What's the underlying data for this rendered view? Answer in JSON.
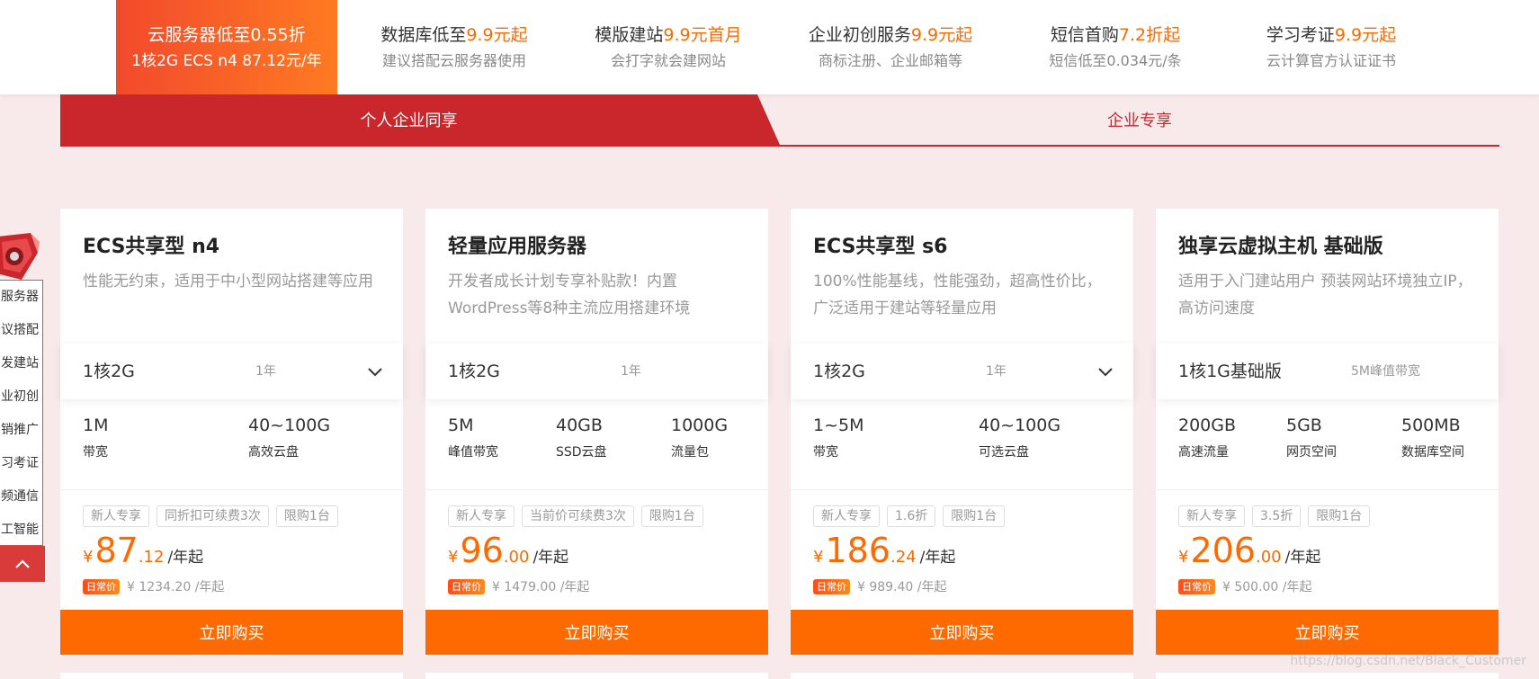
{
  "topnav": {
    "items": [
      {
        "title": "云服务器低至0.55折",
        "title_pre": "云服务器低至",
        "title_hl": "0.55折",
        "sub": "1核2G ECS n4 87.12元/年",
        "active": true
      },
      {
        "title_pre": "数据库低至",
        "title_hl": "9.9元起",
        "sub": "建议搭配云服务器使用"
      },
      {
        "title_pre": "模版建站",
        "title_hl": "9.9元首月",
        "sub": "会打字就会建网站"
      },
      {
        "title_pre": "企业初创服务",
        "title_hl": "9.9元起",
        "sub": "商标注册、企业邮箱等"
      },
      {
        "title_pre": "短信首购",
        "title_hl": "7.2折起",
        "sub": "短信低至0.034元/条"
      },
      {
        "title_pre": "学习考证",
        "title_hl": "9.9元起",
        "sub": "云计算官方认证证书"
      }
    ]
  },
  "tabs": {
    "left": "个人企业同享",
    "right": "企业专享"
  },
  "side": {
    "items": [
      "服务器",
      "议搭配",
      "发建站",
      "业初创",
      "销推广",
      "习考证",
      "频通信",
      "工智能"
    ]
  },
  "cards": [
    {
      "title": "ECS共享型 n4",
      "desc": "性能无约束，适用于中小型网站搭建等应用",
      "config": "1核2G",
      "period": "1年",
      "metrics": [
        {
          "value": "1M",
          "label": "带宽"
        },
        {
          "value": "40~100G",
          "label": "高效云盘"
        }
      ],
      "tags": [
        "新人专享",
        "同折扣可续费3次",
        "限购1台"
      ],
      "price_currency": "¥",
      "price_int": "87",
      "price_dec": ".12",
      "price_unit": "/年起",
      "orig_badge": "日常价",
      "orig_price": "¥ 1234.20 /年起",
      "buy_label": "立即购买"
    },
    {
      "title": "轻量应用服务器",
      "desc": "开发者成长计划专享补贴款！内置WordPress等8种主流应用搭建环境",
      "config": "1核2G",
      "period": "1年",
      "metrics": [
        {
          "value": "5M",
          "label": "峰值带宽"
        },
        {
          "value": "40GB",
          "label": "SSD云盘"
        },
        {
          "value": "1000G",
          "label": "流量包"
        }
      ],
      "tags": [
        "新人专享",
        "当前价可续费3次",
        "限购1台"
      ],
      "price_currency": "¥",
      "price_int": "96",
      "price_dec": ".00",
      "price_unit": "/年起",
      "orig_badge": "日常价",
      "orig_price": "¥ 1479.00 /年起",
      "buy_label": "立即购买"
    },
    {
      "title": "ECS共享型 s6",
      "desc": "100%性能基线，性能强劲，超高性价比，广泛适用于建站等轻量应用",
      "config": "1核2G",
      "period": "1年",
      "metrics": [
        {
          "value": "1~5M",
          "label": "带宽"
        },
        {
          "value": "40~100G",
          "label": "可选云盘"
        }
      ],
      "tags": [
        "新人专享",
        "1.6折",
        "限购1台"
      ],
      "price_currency": "¥",
      "price_int": "186",
      "price_dec": ".24",
      "price_unit": "/年起",
      "orig_badge": "日常价",
      "orig_price": "¥ 989.40 /年起",
      "buy_label": "立即购买"
    },
    {
      "title": "独享云虚拟主机 基础版",
      "desc": "适用于入门建站用户 预装网站环境独立IP，高访问速度",
      "config": "1核1G基础版",
      "period": "5M峰值带宽",
      "metrics": [
        {
          "value": "200GB",
          "label": "高速流量"
        },
        {
          "value": "5GB",
          "label": "网页空间"
        },
        {
          "value": "500MB",
          "label": "数据库空间"
        }
      ],
      "tags": [
        "新人专享",
        "3.5折",
        "限购1台"
      ],
      "price_currency": "¥",
      "price_int": "206",
      "price_dec": ".00",
      "price_unit": "/年起",
      "orig_badge": "日常价",
      "orig_price": "¥ 500.00 /年起",
      "buy_label": "立即购买"
    }
  ],
  "watermark": "https://blog.csdn.net/Black_Customer",
  "colors": {
    "accent": "#ff6a00",
    "brand_red": "#c9272c",
    "bg": "#f8eaea"
  }
}
